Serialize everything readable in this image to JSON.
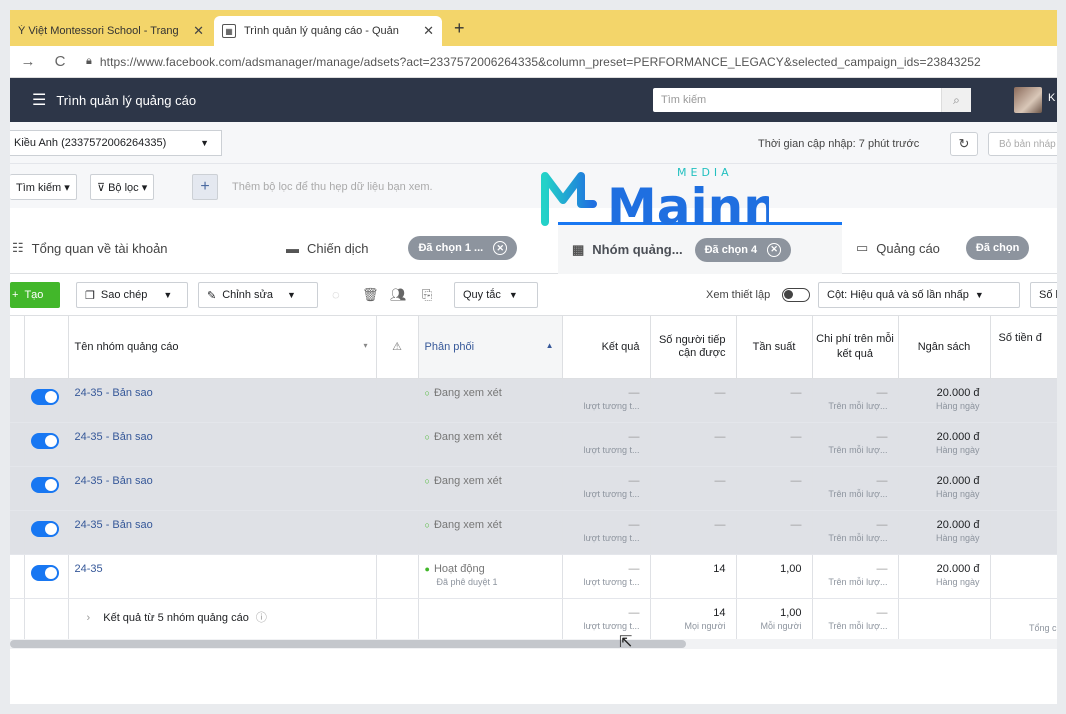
{
  "browser": {
    "tabs": [
      {
        "title": "Ý Việt Montessori School - Trang"
      },
      {
        "title": "Trình quản lý quảng cáo - Quản"
      }
    ],
    "new_tab": "+",
    "close": "✕",
    "url": "https://www.facebook.com/adsmanager/manage/adsets?act=2337572006264335&column_preset=PERFORMANCE_LEGACY&selected_campaign_ids=23843252"
  },
  "header": {
    "app_title": "Trình quản lý quảng cáo",
    "search_placeholder": "Tìm kiếm",
    "user_initial": "K"
  },
  "account": {
    "name": "Kiều Anh (2337572006264335)",
    "update_time": "Thời gian cập nhập: 7 phút trước",
    "draft_button": "Bỏ bản nháp"
  },
  "filters": {
    "search": "Tìm kiếm ▾",
    "filter": "Bộ lọc ▾",
    "hint": "Thêm bộ lọc để thu hẹp dữ liệu bạn xem."
  },
  "watermark": {
    "brand": "Mainn",
    "sub": "MEDIA"
  },
  "level_tabs": {
    "overview": "Tổng quan về tài khoản",
    "campaigns": "Chiến dịch",
    "campaigns_pill": "Đã chọn 1 ...",
    "adsets": "Nhóm quảng...",
    "adsets_pill": "Đã chọn 4",
    "ads": "Quảng cáo",
    "ads_pill": "Đã chọn"
  },
  "toolbar": {
    "create": "Tạo",
    "duplicate": "Sao chép",
    "edit": "Chỉnh sửa",
    "rules": "Quy tắc",
    "view_setup": "Xem thiết lập",
    "columns": "Cột: Hiệu quả và số lần nhấp",
    "breakdown": "Số l"
  },
  "table": {
    "headers": {
      "name": "Tên nhóm quảng cáo",
      "delivery": "Phân phối",
      "results": "Kết quả",
      "reach": "Số người tiếp cận được",
      "frequency": "Tần suất",
      "cost": "Chi phí trên mỗi kết quả",
      "budget": "Ngân sách",
      "spent": "Số tiền đ"
    },
    "rows": [
      {
        "name": "24-35 - Bản sao",
        "status": "Đang xem xét",
        "status_sub": "",
        "result_sub": "lượt tương t...",
        "reach": "—",
        "freq": "—",
        "cost_sub": "Trên mỗi lượ...",
        "budget": "20.000 đ",
        "budget_sub": "Hàng ngày"
      },
      {
        "name": "24-35 - Bản sao",
        "status": "Đang xem xét",
        "status_sub": "",
        "result_sub": "lượt tương t...",
        "reach": "—",
        "freq": "—",
        "cost_sub": "Trên mỗi lượ...",
        "budget": "20.000 đ",
        "budget_sub": "Hàng ngày"
      },
      {
        "name": "24-35 - Bản sao",
        "status": "Đang xem xét",
        "status_sub": "",
        "result_sub": "lượt tương t...",
        "reach": "—",
        "freq": "—",
        "cost_sub": "Trên mỗi lượ...",
        "budget": "20.000 đ",
        "budget_sub": "Hàng ngày"
      },
      {
        "name": "24-35 - Bản sao",
        "status": "Đang xem xét",
        "status_sub": "",
        "result_sub": "lượt tương t...",
        "reach": "—",
        "freq": "—",
        "cost_sub": "Trên mỗi lượ...",
        "budget": "20.000 đ",
        "budget_sub": "Hàng ngày"
      },
      {
        "name": "24-35",
        "status": "Hoạt động",
        "status_sub": "Đã phê duyệt 1",
        "result_sub": "lượt tương t...",
        "reach": "14",
        "freq": "1,00",
        "cost_sub": "Trên mỗi lượ...",
        "budget": "20.000 đ",
        "budget_sub": "Hàng ngày"
      }
    ],
    "summary": {
      "label": "Kết quả từ 5 nhóm quảng cáo",
      "result_sub": "lượt tương t...",
      "reach": "14",
      "reach_sub": "Mọi người",
      "freq": "1,00",
      "freq_sub": "Mỗi người",
      "cost_sub": "Trên mỗi lượ...",
      "spent_sub": "Tổng c"
    }
  },
  "dash": "—"
}
